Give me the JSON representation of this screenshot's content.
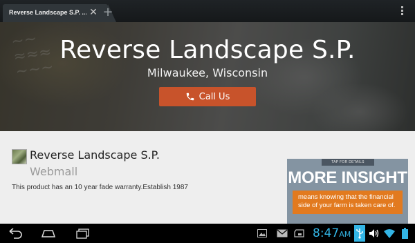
{
  "browser": {
    "tab_title": "Reverse Landscape S.P. ...",
    "close_icon": "close-icon",
    "new_tab_icon": "plus-icon",
    "menu_icon": "overflow-menu-icon"
  },
  "hero": {
    "title": "Reverse Landscape S.P.",
    "subtitle": "Milwaukee, Wisconsin",
    "call_label": "Call Us",
    "call_icon": "phone-icon"
  },
  "business": {
    "name": "Reverse Landscape S.P.",
    "subname": "Webmall",
    "description": "This product has an 10 year fade warranty.Establish 1987"
  },
  "ad": {
    "tap_label": "TAP FOR DETAILS",
    "headline": "MORE INSIGHT",
    "body": "means knowing that the financial side of your farm is taken care of.",
    "colors": {
      "background": "#8494a2",
      "accent": "#e27a1f"
    }
  },
  "system": {
    "time": "8:47",
    "ampm": "AM",
    "accent": "#33b5e5"
  }
}
